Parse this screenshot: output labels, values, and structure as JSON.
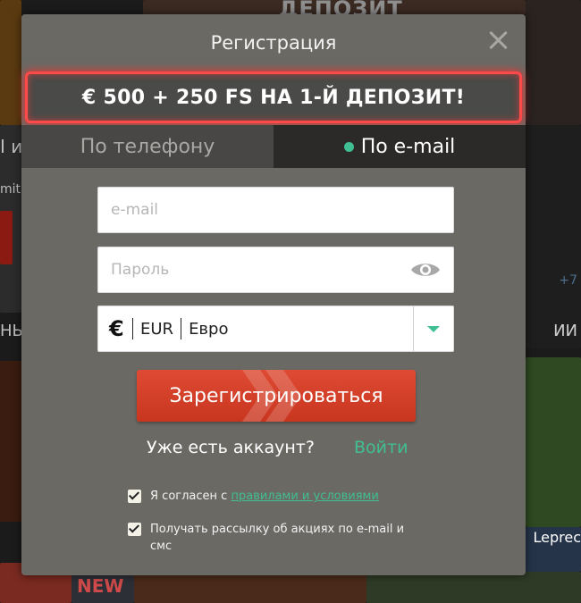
{
  "background": {
    "top_word": "ДЕПОЗИТ",
    "left_text_1": "I и",
    "left_text_2": "mit",
    "left_text_3": "НЫ",
    "right_text": "ИИ",
    "right_small": "+7",
    "new_badge": "NEW",
    "leprechaun": "Leprec"
  },
  "modal": {
    "title": "Регистрация",
    "close_icon": "close-icon",
    "promo": "€ 500 + 250 FS НА 1-Й ДЕПОЗИТ!",
    "tabs": [
      {
        "label": "По телефону",
        "active": false
      },
      {
        "label": "По e-mail",
        "active": true
      }
    ],
    "email": {
      "placeholder": "e-mail",
      "value": ""
    },
    "password": {
      "placeholder": "Пароль",
      "value": "",
      "icon": "eye-icon"
    },
    "currency": {
      "symbol": "€",
      "code": "EUR",
      "name": "Евро"
    },
    "register_label": "Зарегистрироваться",
    "have_account": "Уже есть аккаунт?",
    "login_label": "Войти",
    "agree_prefix": "Я согласен с ",
    "agree_link": "правилами и условиями",
    "newsletter": "Получать рассылку об акциях по e-mail и смс"
  },
  "colors": {
    "accent_green": "#3fbf93",
    "promo_border": "#ff4a4a",
    "register_red": "#d5412a",
    "modal_bg": "#6b6964"
  }
}
